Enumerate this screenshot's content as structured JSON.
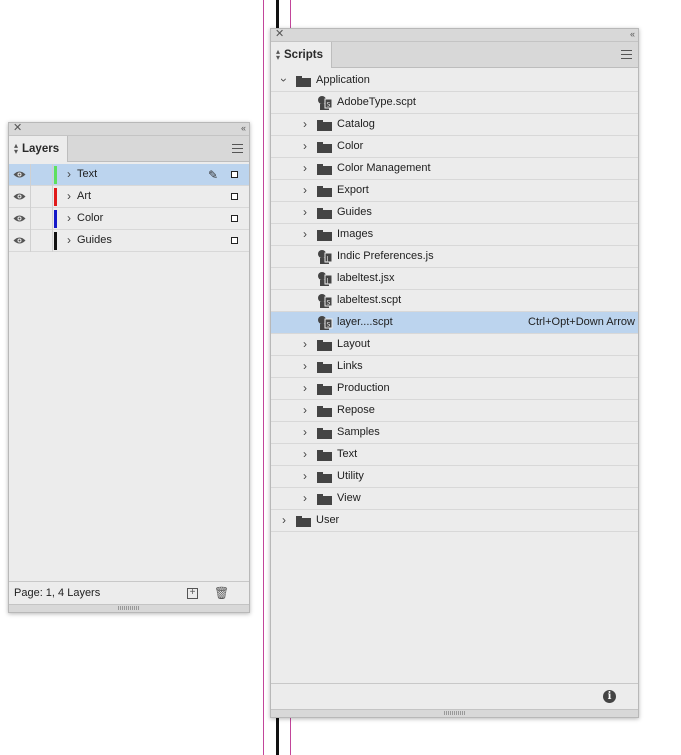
{
  "layers_panel": {
    "title": "Layers",
    "footer_text": "Page: 1, 4 Layers",
    "layers": [
      {
        "name": "Text",
        "color": "#5ee05e",
        "selected": true
      },
      {
        "name": "Art",
        "color": "#e01919",
        "selected": false
      },
      {
        "name": "Color",
        "color": "#1418c8",
        "selected": false
      },
      {
        "name": "Guides",
        "color": "#111111",
        "selected": false
      }
    ],
    "icons": {
      "visibility": "eye-icon",
      "edit": "pen-icon",
      "new": "new-layer-icon",
      "delete": "trash-icon"
    }
  },
  "scripts_panel": {
    "title": "Scripts",
    "items": [
      {
        "label": "Application",
        "type": "folder",
        "level": 0,
        "expanded": true
      },
      {
        "label": "AdobeType.scpt",
        "type": "applescript",
        "level": 1
      },
      {
        "label": "Catalog",
        "type": "folder",
        "level": 1
      },
      {
        "label": "Color",
        "type": "folder",
        "level": 1
      },
      {
        "label": "Color Management",
        "type": "folder",
        "level": 1
      },
      {
        "label": "Export",
        "type": "folder",
        "level": 1
      },
      {
        "label": "Guides",
        "type": "folder",
        "level": 1
      },
      {
        "label": "Images",
        "type": "folder",
        "level": 1
      },
      {
        "label": "Indic Preferences.js",
        "type": "javascript",
        "level": 1
      },
      {
        "label": "labeltest.jsx",
        "type": "javascript",
        "level": 1
      },
      {
        "label": "labeltest.scpt",
        "type": "applescript",
        "level": 1
      },
      {
        "label": "layer....scpt",
        "type": "applescript",
        "level": 1,
        "selected": true,
        "shortcut": "Ctrl+Opt+Down Arrow"
      },
      {
        "label": "Layout",
        "type": "folder",
        "level": 1
      },
      {
        "label": "Links",
        "type": "folder",
        "level": 1
      },
      {
        "label": "Production",
        "type": "folder",
        "level": 1
      },
      {
        "label": "Repose",
        "type": "folder",
        "level": 1
      },
      {
        "label": "Samples",
        "type": "folder",
        "level": 1
      },
      {
        "label": "Text",
        "type": "folder",
        "level": 1
      },
      {
        "label": "Utility",
        "type": "folder",
        "level": 1
      },
      {
        "label": "View",
        "type": "folder",
        "level": 1
      },
      {
        "label": "User",
        "type": "folder",
        "level": 0
      }
    ],
    "icons": {
      "info": "info-icon"
    }
  },
  "colors": {
    "selection": "#bcd4ee",
    "panel_bg": "#ececec",
    "guide_magenta": "#c2459a"
  }
}
